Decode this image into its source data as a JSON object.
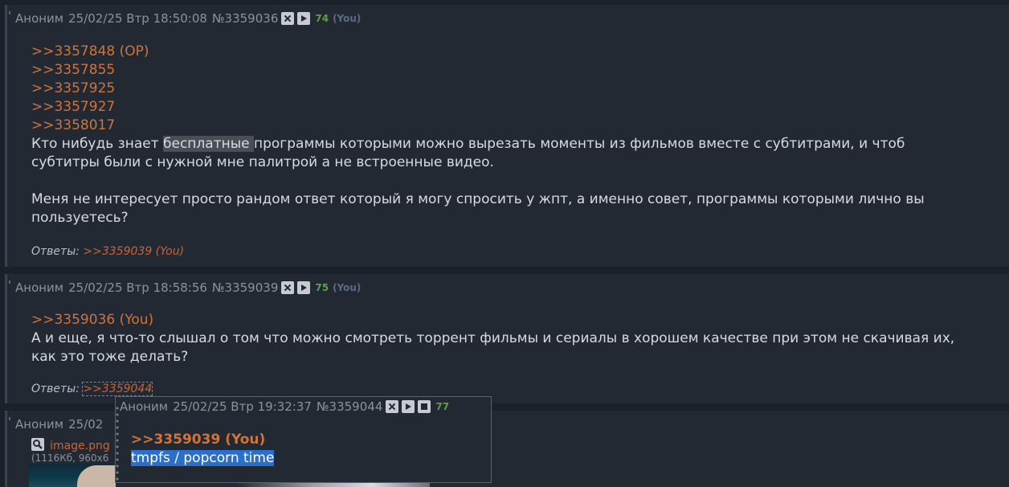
{
  "post1": {
    "author": "Аноним",
    "datetime": "25/02/25 Втр 18:50:08",
    "number": "№3359036",
    "count": "74",
    "you": "(You)",
    "refs": [
      ">>3357848 (OP)",
      ">>3357855",
      ">>3357925",
      ">>3357927",
      ">>3358017"
    ],
    "text_pre": "Кто нибудь знает ",
    "text_hl": "бесплатные ",
    "text_post": "программы которыми можно вырезать моменты из фильмов вместе с субтитрами, и чтоб",
    "text_line2": "субтитры были с нужной мне палитрой а не встроенные видео.",
    "text_para2_l1": "Меня не интересует просто рандом ответ который я могу спросить у жпт, а именно совет, программы которыми лично вы",
    "text_para2_l2": "пользуетесь?",
    "replies_label": "Ответы:",
    "replies_link": ">>3359039 (You)"
  },
  "post2": {
    "author": "Аноним",
    "datetime": "25/02/25 Втр 18:58:56",
    "number": "№3359039",
    "count": "75",
    "you": "(You)",
    "ref": ">>3359036 (You)",
    "text_l1": "А и еще, я что-то слышал о том что можно смотреть торрент фильмы и сериалы в хорошем качестве при этом не скачивая их,",
    "text_l2": "как это тоже делать?",
    "replies_label": "Ответы:",
    "replies_link": ">>3359044"
  },
  "post3": {
    "author": "Аноним",
    "datetime_partial": "25/02",
    "file_name": "image.png",
    "file_meta": "(1116Кб, 960x6"
  },
  "popup": {
    "author": "Аноним",
    "datetime": "25/02/25 Втр 19:32:37",
    "number": "№3359044",
    "count": "77",
    "ref": ">>3359039 (You)",
    "text": "tmpfs / popcorn time"
  },
  "colors": {
    "background": "#1b212a",
    "post_bg": "#222933",
    "link": "#d1733b",
    "count": "#5e9e4a",
    "selection": "#2a6fc9"
  }
}
